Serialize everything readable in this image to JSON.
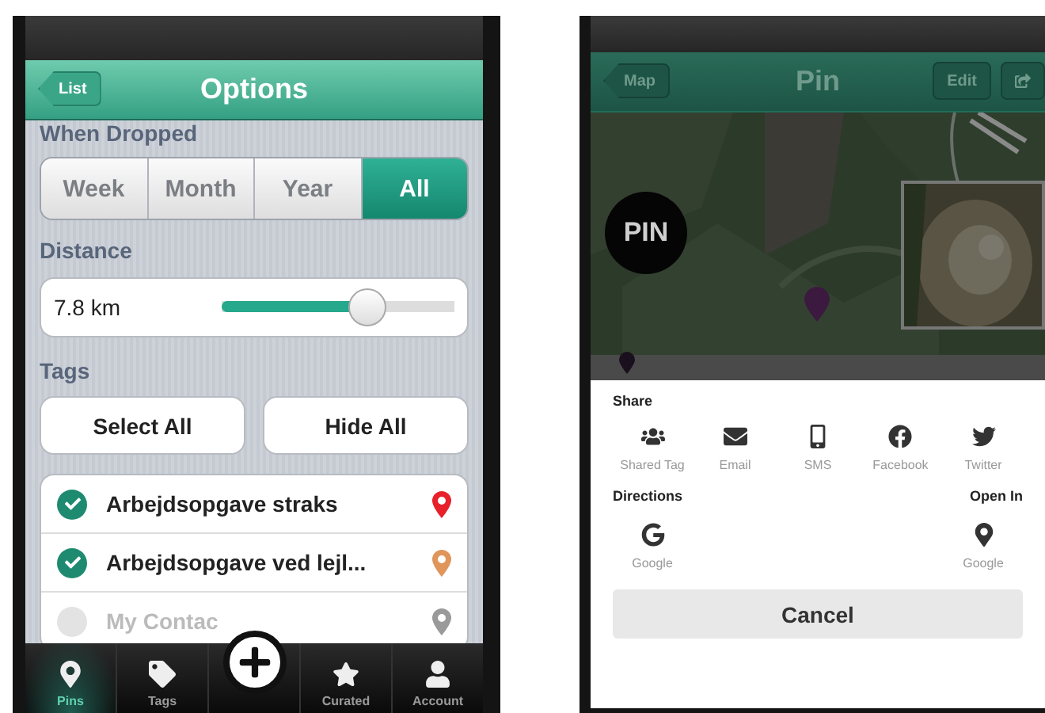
{
  "options_screen": {
    "nav": {
      "back": "List",
      "title": "Options"
    },
    "when_dropped": {
      "label": "When Dropped",
      "segments": [
        {
          "label": "Week",
          "selected": false
        },
        {
          "label": "Month",
          "selected": false
        },
        {
          "label": "Year",
          "selected": false
        },
        {
          "label": "All",
          "selected": true
        }
      ]
    },
    "distance": {
      "label": "Distance",
      "reading": "7.8 km",
      "level": 0.62
    },
    "tags": {
      "label": "Tags",
      "buttons": [
        "Select All",
        "Hide All"
      ],
      "items": [
        {
          "name": "Arbejdsopgave straks",
          "checked": true,
          "color": "#e8202a"
        },
        {
          "name": "Arbejdsopgave ved lejl...",
          "checked": true,
          "color": "#e0955a"
        },
        {
          "name": "My Contac",
          "checked": false,
          "color": "#9a9a9a"
        }
      ]
    },
    "tab_bar": [
      {
        "kind": "pins",
        "label": "Pins",
        "selected": true
      },
      {
        "kind": "tags",
        "label": "Tags",
        "selected": false
      },
      {
        "kind": "add",
        "selected": false
      },
      {
        "kind": "curated",
        "label": "Curated",
        "selected": false
      },
      {
        "kind": "account",
        "label": "Account",
        "selected": false
      }
    ]
  },
  "pin_screen": {
    "nav": {
      "back": "Map",
      "title": "Pin",
      "edit": "Edit"
    },
    "badge": "PIN",
    "sheet": {
      "share_label": "Share",
      "share": [
        {
          "kind": "shared-tag",
          "label": "Shared Tag"
        },
        {
          "kind": "email",
          "label": "Email"
        },
        {
          "kind": "sms",
          "label": "SMS"
        },
        {
          "kind": "facebook",
          "label": "Facebook"
        },
        {
          "kind": "twitter",
          "label": "Twitter"
        }
      ],
      "directions_label": "Directions",
      "directions": [
        {
          "kind": "google",
          "label": "Google"
        }
      ],
      "open_in_label": "Open In",
      "open_in": [
        {
          "kind": "pin",
          "label": "Google"
        }
      ],
      "cancel": "Cancel"
    }
  }
}
